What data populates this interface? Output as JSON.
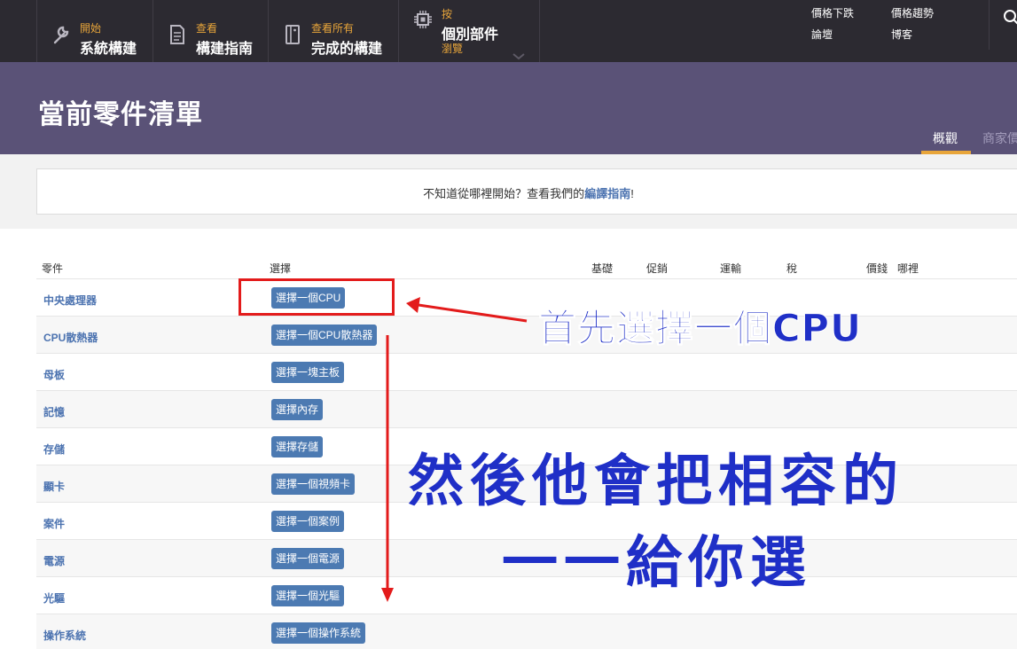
{
  "nav": {
    "items": [
      {
        "small": "開始",
        "big": "系統構建",
        "icon": "wrench-icon"
      },
      {
        "small": "查看",
        "big": "構建指南",
        "icon": "document-icon"
      },
      {
        "small": "查看所有",
        "big": "完成的構建",
        "icon": "case-icon"
      },
      {
        "small": "按",
        "big": "個別部件",
        "sub": "瀏覽",
        "icon": "chip-icon"
      }
    ],
    "links": [
      "價格下跌",
      "價格趨勢",
      "論壇",
      "博客"
    ],
    "search_icon": "search-icon"
  },
  "banner": {
    "title": "當前零件清單",
    "tabs": [
      "概觀",
      "商家價"
    ]
  },
  "notice": {
    "text": "不知道從哪裡開始？查看我們的",
    "link": "編譯指南",
    "suffix": "!"
  },
  "table": {
    "headers": [
      "零件",
      "選擇",
      "基礎",
      "促銷",
      "運輸",
      "稅",
      "價錢",
      "哪裡"
    ],
    "rows": [
      {
        "label": "中央處理器",
        "button": "選擇一個CPU"
      },
      {
        "label": "CPU散熱器",
        "button": "選擇一個CPU散熱器"
      },
      {
        "label": "母板",
        "button": "選擇一塊主板"
      },
      {
        "label": "記憶",
        "button": "選擇內存"
      },
      {
        "label": "存儲",
        "button": "選擇存儲"
      },
      {
        "label": "顯卡",
        "button": "選擇一個視頻卡"
      },
      {
        "label": "案件",
        "button": "選擇一個案例"
      },
      {
        "label": "電源",
        "button": "選擇一個電源"
      },
      {
        "label": "光驅",
        "button": "選擇一個光驅"
      },
      {
        "label": "操作系統",
        "button": "選擇一個操作系統"
      }
    ]
  },
  "annotations": {
    "first": "首先選擇一個CPU",
    "line1": "然後他會把相容的",
    "line2": "一一給你選"
  },
  "colors": {
    "nav_bg": "#2c2a31",
    "accent": "#e8a53a",
    "banner_bg": "#5a5277",
    "link": "#4c73b0",
    "button": "#4c7ab2",
    "annotation_text": "#1f2fc7",
    "annotation_red": "#e31b1b"
  }
}
